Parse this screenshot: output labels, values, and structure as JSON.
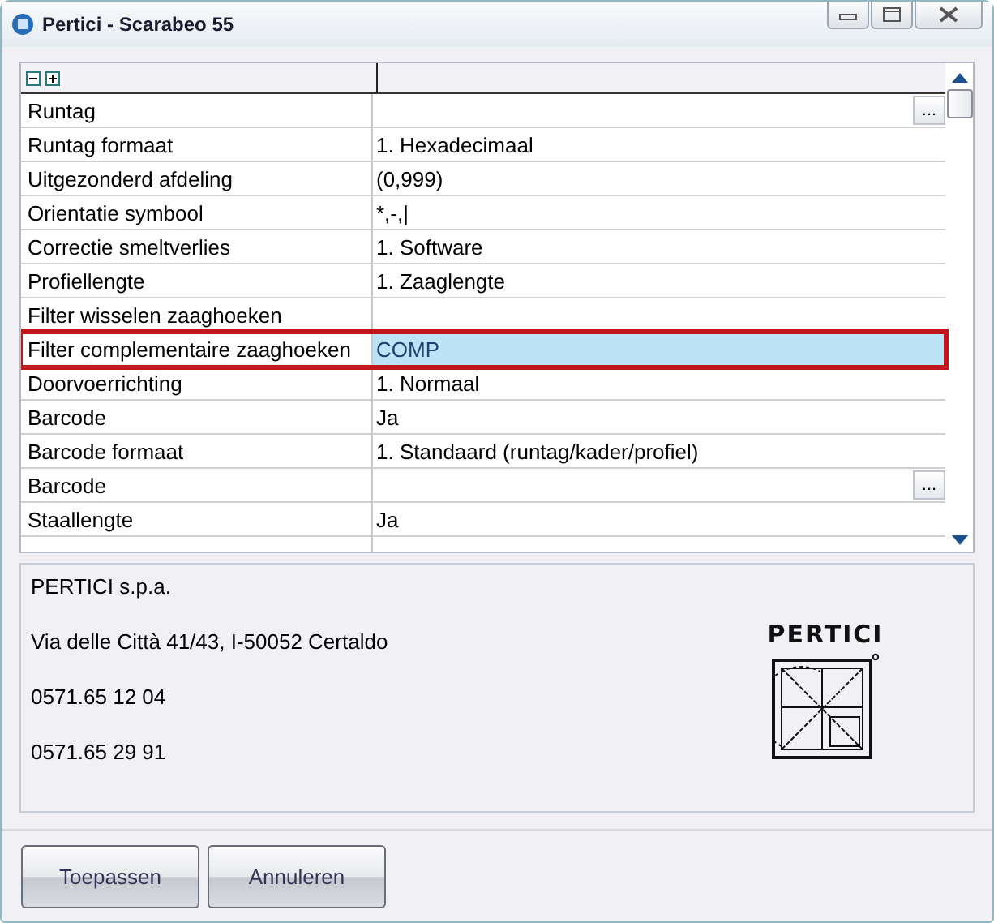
{
  "window": {
    "title": "Pertici - Scarabeo 55"
  },
  "grid": {
    "rows": [
      {
        "name": "Runtag",
        "value": "",
        "has_button": true,
        "selected": false
      },
      {
        "name": "Runtag formaat",
        "value": "1. Hexadecimaal",
        "has_button": false,
        "selected": false
      },
      {
        "name": "Uitgezonderd afdeling",
        "value": "(0,999)",
        "has_button": false,
        "selected": false
      },
      {
        "name": "Orientatie symbool",
        "value": "*,-,|",
        "has_button": false,
        "selected": false
      },
      {
        "name": "Correctie smeltverlies",
        "value": "1. Software",
        "has_button": false,
        "selected": false
      },
      {
        "name": "Profiellengte",
        "value": "1. Zaaglengte",
        "has_button": false,
        "selected": false
      },
      {
        "name": "Filter wisselen zaaghoeken",
        "value": "",
        "has_button": false,
        "selected": false
      },
      {
        "name": "Filter complementaire zaaghoeken",
        "value": "COMP",
        "has_button": false,
        "selected": true
      },
      {
        "name": "Doorvoerrichting",
        "value": "1. Normaal",
        "has_button": false,
        "selected": false
      },
      {
        "name": "Barcode",
        "value": "Ja",
        "has_button": false,
        "selected": false
      },
      {
        "name": "Barcode formaat",
        "value": "1. Standaard (runtag/kader/profiel)",
        "has_button": false,
        "selected": false
      },
      {
        "name": "Barcode",
        "value": "",
        "has_button": true,
        "selected": false
      },
      {
        "name": "Staallengte",
        "value": "Ja",
        "has_button": false,
        "selected": false
      }
    ],
    "button_label": "..."
  },
  "info": {
    "lines": [
      "PERTICI s.p.a.",
      "Via delle Città 41/43, I-50052 Certaldo",
      "0571.65 12 04",
      "0571.65 29 91"
    ],
    "logo_text": "PERTICI"
  },
  "buttons": [
    "Toepassen",
    "Annuleren"
  ]
}
